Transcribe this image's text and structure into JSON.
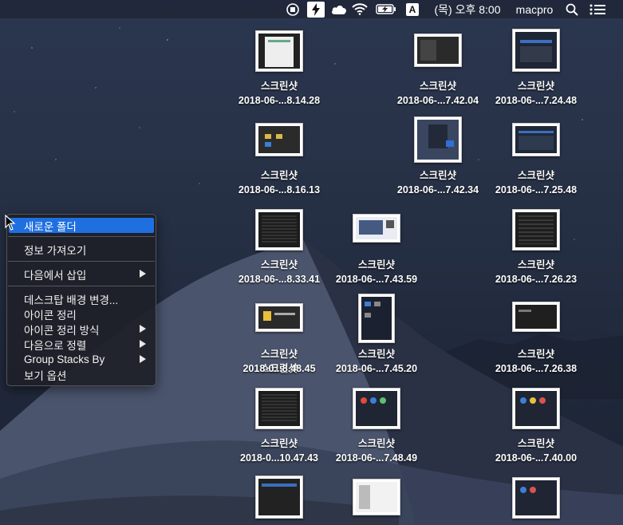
{
  "menubar": {
    "clock": "(목) 오후 8:00",
    "user": "macpro",
    "input_source": "A",
    "icons": [
      "stop-record-icon",
      "lightning-icon",
      "cloud-icon",
      "wifi-icon",
      "battery-charging-icon",
      "input-source-icon",
      "spotlight-search-icon",
      "notification-list-icon"
    ]
  },
  "desktop": {
    "icons": [
      {
        "name": "스크린샷",
        "date": "2018-06-...8.14.28"
      },
      {
        "name": "스크린샷",
        "date": "2018-06-...7.42.04"
      },
      {
        "name": "스크린샷",
        "date": "2018-06-...7.24.48"
      },
      {
        "name": "스크린샷",
        "date": "2018-06-...8.16.13"
      },
      {
        "name": "스크린샷",
        "date": "2018-06-...7.42.34"
      },
      {
        "name": "스크린샷",
        "date": "2018-06-...7.25.48"
      },
      {
        "name": "스크린샷",
        "date": "2018-06-...8.33.41"
      },
      {
        "name": "스크린샷",
        "date": "2018-06-...7.43.59"
      },
      {
        "name": "스크린샷",
        "date": "2018-06-...7.26.23"
      },
      {
        "name": "스크린샷",
        "date": "2018-0...8.48.45"
      },
      {
        "name": "스크린샷",
        "date": "2018-06-...7.45.20"
      },
      {
        "name": "스크린샷",
        "date": "2018-06-...7.26.38"
      },
      {
        "name": "스크린샷",
        "date": "2018-0...10.47.43"
      },
      {
        "name": "스크린샷",
        "date": "2018-06-...7.48.49"
      },
      {
        "name": "스크린샷",
        "date": "2018-06-...7.40.00"
      },
      {
        "name": "",
        "date": ""
      },
      {
        "name": "",
        "date": ""
      },
      {
        "name": "",
        "date": ""
      }
    ]
  },
  "context_menu": {
    "new_folder": "새로운 폴더",
    "get_info": "정보 가져오기",
    "import_from": "다음에서 삽입",
    "change_bg": "데스크탑 배경 변경...",
    "clean_up": "아이콘 정리",
    "clean_up_by": "아이콘 정리 방식",
    "sort_by": "다음으로 정렬",
    "group_stacks": "Group Stacks By",
    "view_options": "보기 옵션"
  },
  "colors": {
    "selection": "#1f6fe0",
    "menu_bg": "#1e2028"
  }
}
